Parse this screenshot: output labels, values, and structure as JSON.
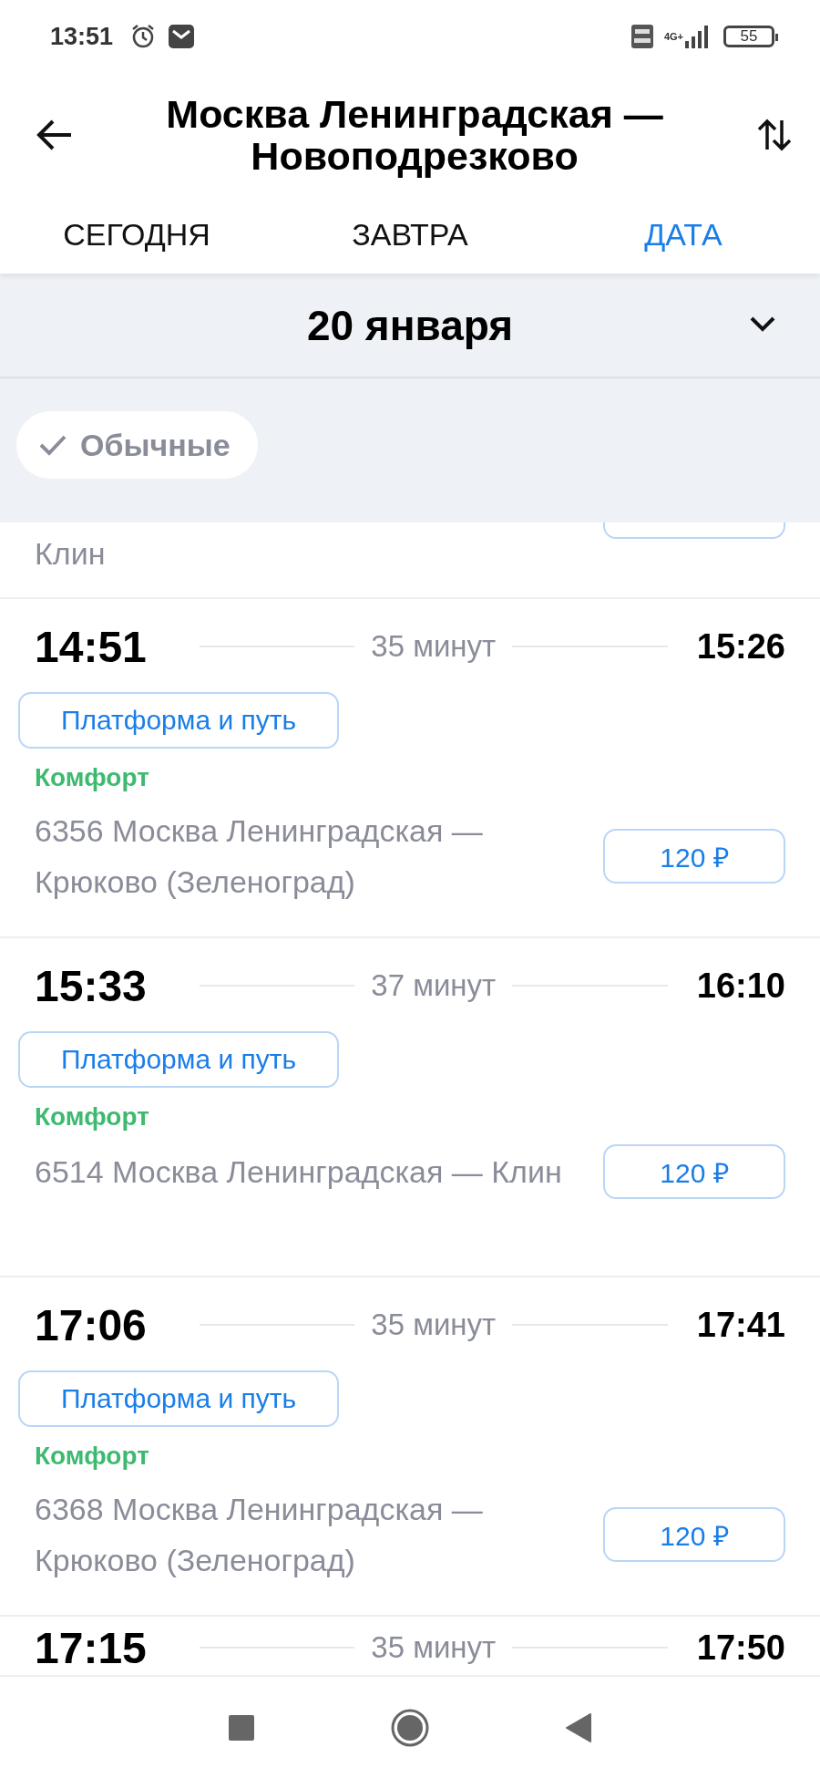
{
  "status_bar": {
    "time": "13:51",
    "network": "4G+",
    "battery": "55"
  },
  "header": {
    "title": "Москва Ленинградская — Новоподрезково"
  },
  "tabs": [
    {
      "label": "СЕГОДНЯ",
      "selected": false
    },
    {
      "label": "ЗАВТРА",
      "selected": false
    },
    {
      "label": "ДАТА",
      "selected": true
    }
  ],
  "date_picker": {
    "value": "20 января"
  },
  "filters": [
    {
      "label": "Обычные",
      "checked": true
    }
  ],
  "trains": [
    {
      "kind": "partial",
      "route": "Клин"
    },
    {
      "kind": "full",
      "departure": "14:51",
      "duration": "35 минут",
      "arrival": "15:26",
      "platform_button": "Платформа и путь",
      "train_class": "Комфорт",
      "route": "6356 Москва Ленинградская — Крюково (Зеленоград)",
      "price": "120 ₽"
    },
    {
      "kind": "full",
      "departure": "15:33",
      "duration": "37 минут",
      "arrival": "16:10",
      "platform_button": "Платформа и путь",
      "train_class": "Комфорт",
      "route": "6514 Москва Ленинградская — Клин",
      "price": "120 ₽"
    },
    {
      "kind": "full",
      "departure": "17:06",
      "duration": "35 минут",
      "arrival": "17:41",
      "platform_button": "Платформа и путь",
      "train_class": "Комфорт",
      "route": "6368 Москва Ленинградская — Крюково (Зеленоград)",
      "price": "120 ₽"
    },
    {
      "kind": "header_only",
      "departure": "17:15",
      "duration": "35 минут",
      "arrival": "17:50"
    }
  ]
}
